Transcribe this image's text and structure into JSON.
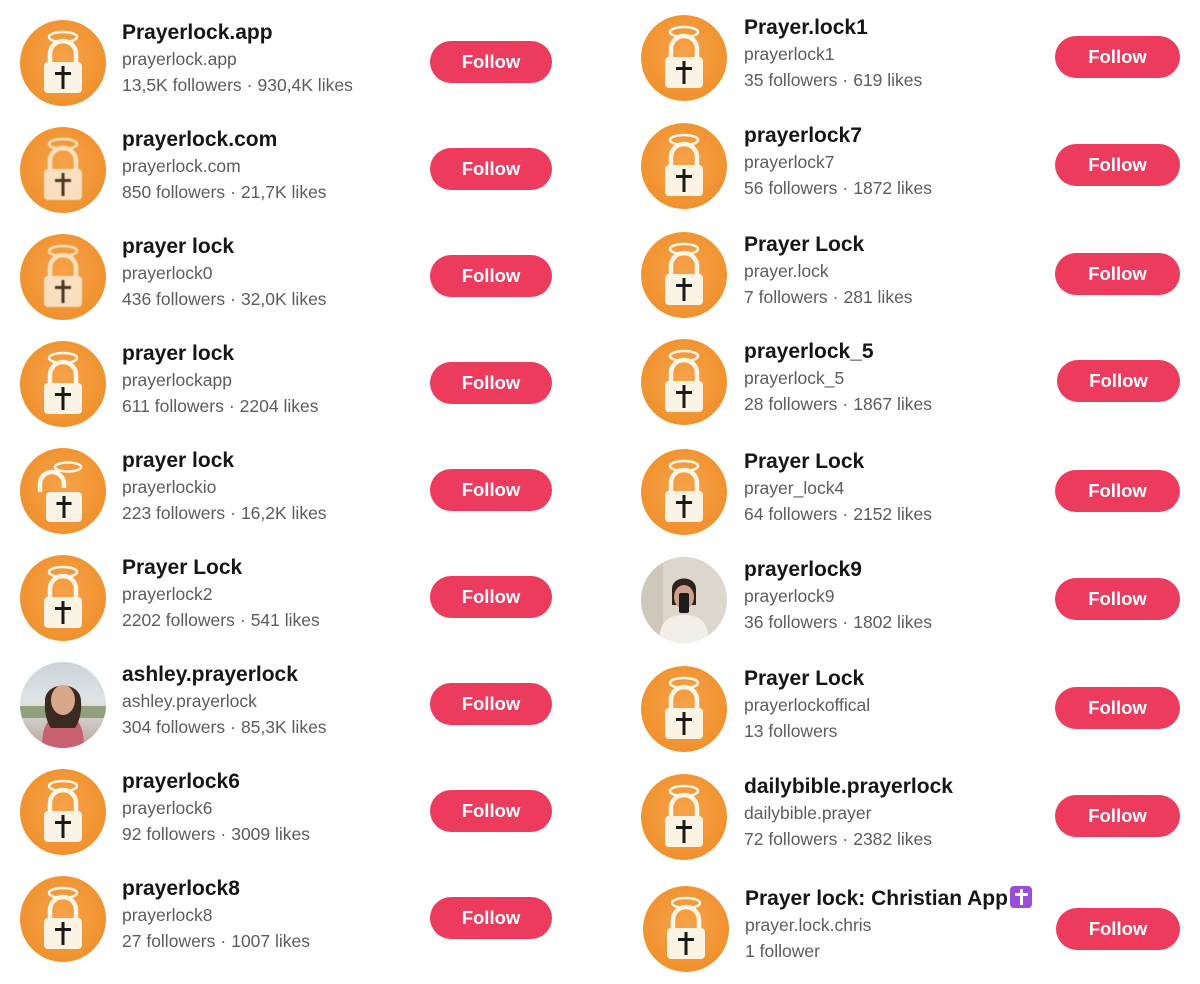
{
  "colors": {
    "follow_button": "#ec3b5c",
    "avatar_orange": "#f0922f"
  },
  "left": [
    {
      "name": "Prayerlock.app",
      "handle": "prayerlock.app",
      "followers": "13,5K followers",
      "likes": "930,4K likes",
      "avatar": "lock-icon",
      "follow": "Follow"
    },
    {
      "name": "prayerlock.com",
      "handle": "prayerlock.com",
      "followers": "850 followers",
      "likes": "21,7K likes",
      "avatar": "lock-icon",
      "follow": "Follow"
    },
    {
      "name": "prayer lock",
      "handle": "prayerlock0",
      "followers": "436 followers",
      "likes": "32,0K likes",
      "avatar": "lock-icon",
      "follow": "Follow"
    },
    {
      "name": "prayer lock",
      "handle": "prayerlockapp",
      "followers": "611 followers",
      "likes": "2204 likes",
      "avatar": "lock-icon",
      "follow": "Follow"
    },
    {
      "name": "prayer lock",
      "handle": "prayerlockio",
      "followers": "223 followers",
      "likes": "16,2K likes",
      "avatar": "open-lock-icon",
      "follow": "Follow"
    },
    {
      "name": "Prayer Lock",
      "handle": "prayerlock2",
      "followers": "2202 followers",
      "likes": "541 likes",
      "avatar": "lock-icon",
      "follow": "Follow"
    },
    {
      "name": "ashley.prayerlock",
      "handle": "ashley.prayerlock",
      "followers": "304 followers",
      "likes": "85,3K likes",
      "avatar": "person-photo",
      "follow": "Follow"
    },
    {
      "name": "prayerlock6",
      "handle": "prayerlock6",
      "followers": "92 followers",
      "likes": "3009 likes",
      "avatar": "lock-icon",
      "follow": "Follow"
    },
    {
      "name": "prayerlock8",
      "handle": "prayerlock8",
      "followers": "27 followers",
      "likes": "1007 likes",
      "avatar": "lock-icon",
      "follow": "Follow"
    }
  ],
  "right": [
    {
      "name": "Prayer.lock1",
      "handle": "prayerlock1",
      "followers": "35 followers",
      "likes": "619 likes",
      "avatar": "lock-icon",
      "follow": "Follow"
    },
    {
      "name": "prayerlock7",
      "handle": "prayerlock7",
      "followers": "56 followers",
      "likes": "1872 likes",
      "avatar": "lock-icon",
      "follow": "Follow"
    },
    {
      "name": "Prayer Lock",
      "handle": "prayer.lock",
      "followers": "7 followers",
      "likes": "281 likes",
      "avatar": "lock-icon",
      "follow": "Follow"
    },
    {
      "name": "prayerlock_5",
      "handle": "prayerlock_5",
      "followers": "28 followers",
      "likes": "1867 likes",
      "avatar": "lock-icon",
      "follow": "Follow"
    },
    {
      "name": "Prayer Lock",
      "handle": "prayer_lock4",
      "followers": "64 followers",
      "likes": "2152 likes",
      "avatar": "lock-icon",
      "follow": "Follow"
    },
    {
      "name": "prayerlock9",
      "handle": "prayerlock9",
      "followers": "36 followers",
      "likes": "1802 likes",
      "avatar": "person-photo",
      "follow": "Follow"
    },
    {
      "name": "Prayer Lock",
      "handle": "prayerlockoffical",
      "followers": "13 followers",
      "likes": "",
      "avatar": "lock-icon",
      "follow": "Follow"
    },
    {
      "name": "dailybible.prayerlock",
      "handle": "dailybible.prayer",
      "followers": "72 followers",
      "likes": "2382 likes",
      "avatar": "lock-icon",
      "follow": "Follow"
    },
    {
      "name": "Prayer lock: Christian App",
      "handle": "prayer.lock.chris",
      "followers": "1 follower",
      "likes": "",
      "avatar": "lock-icon",
      "name_emoji": "latin-cross-emoji",
      "follow": "Follow"
    }
  ],
  "separator": "·"
}
